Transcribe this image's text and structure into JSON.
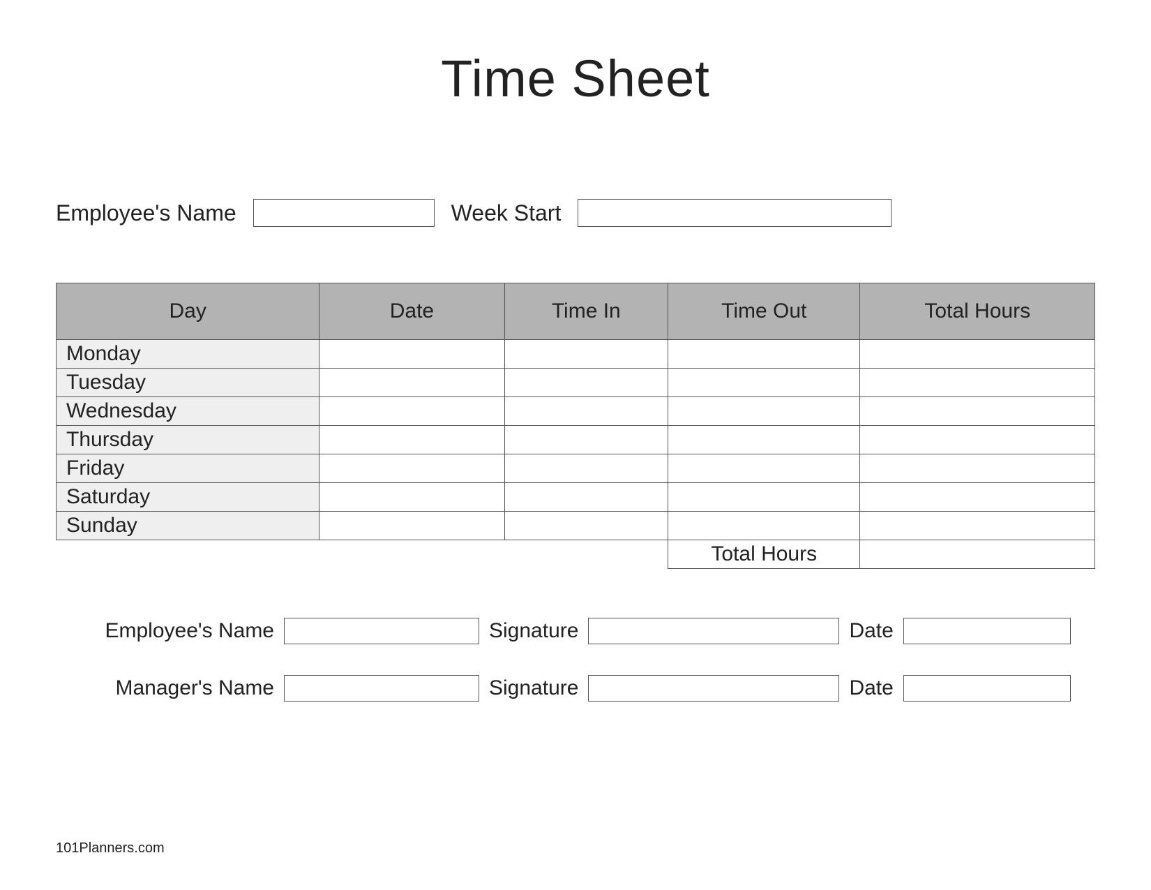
{
  "title": "Time Sheet",
  "top_fields": {
    "employee_name_label": "Employee's Name",
    "employee_name_value": "",
    "week_start_label": "Week Start",
    "week_start_value": ""
  },
  "table": {
    "headers": {
      "day": "Day",
      "date": "Date",
      "time_in": "Time In",
      "time_out": "Time Out",
      "total_hours": "Total Hours"
    },
    "rows": [
      {
        "day": "Monday",
        "date": "",
        "time_in": "",
        "time_out": "",
        "total_hours": ""
      },
      {
        "day": "Tuesday",
        "date": "",
        "time_in": "",
        "time_out": "",
        "total_hours": ""
      },
      {
        "day": "Wednesday",
        "date": "",
        "time_in": "",
        "time_out": "",
        "total_hours": ""
      },
      {
        "day": "Thursday",
        "date": "",
        "time_in": "",
        "time_out": "",
        "total_hours": ""
      },
      {
        "day": "Friday",
        "date": "",
        "time_in": "",
        "time_out": "",
        "total_hours": ""
      },
      {
        "day": "Saturday",
        "date": "",
        "time_in": "",
        "time_out": "",
        "total_hours": ""
      },
      {
        "day": "Sunday",
        "date": "",
        "time_in": "",
        "time_out": "",
        "total_hours": ""
      }
    ],
    "grand_total_label": "Total Hours",
    "grand_total_value": ""
  },
  "signatures": {
    "employee": {
      "name_label": "Employee's Name",
      "name_value": "",
      "signature_label": "Signature",
      "signature_value": "",
      "date_label": "Date",
      "date_value": ""
    },
    "manager": {
      "name_label": "Manager's Name",
      "name_value": "",
      "signature_label": "Signature",
      "signature_value": "",
      "date_label": "Date",
      "date_value": ""
    }
  },
  "footer": "101Planners.com"
}
